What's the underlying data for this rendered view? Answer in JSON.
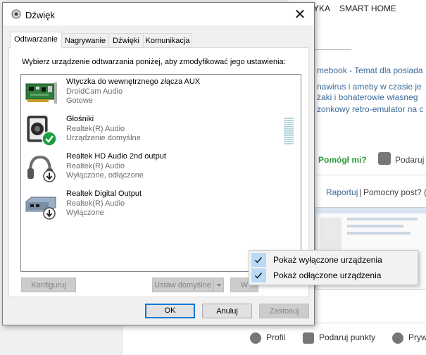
{
  "background_page": {
    "nav": [
      "YKA",
      "SMART HOME"
    ],
    "snippets": [
      "mebook - Temat dla posiada",
      "nawirus i ameby w czasie je",
      "żaki i bohaterowie własneg",
      "zonkowy retro-emulator na c"
    ],
    "help_label": "Pomógł mi?",
    "gift_label": "Podaruj",
    "report_label": "Raportuj",
    "separator": "|",
    "helpful_label": "Pomocny post? (",
    "footer": [
      "Profil",
      "Podaruj punkty",
      "Prywa"
    ]
  },
  "dialog": {
    "title": "Dźwięk",
    "close_glyph": "✕",
    "tabs": [
      "Odtwarzanie",
      "Nagrywanie",
      "Dźwięki",
      "Komunikacja"
    ],
    "instruction": "Wybierz urządzenie odtwarzania poniżej, aby zmodyfikować jego ustawienia:",
    "devices": [
      {
        "name": "Wtyczka do wewnętrznego złącza AUX",
        "driver": "DroidCam Audio",
        "status": "Gotowe",
        "icon": "sound-card-icon"
      },
      {
        "name": "Głośniki",
        "driver": "Realtek(R) Audio",
        "status": "Urządzenie domyślne",
        "icon": "speaker-icon",
        "badge": "default-check-icon"
      },
      {
        "name": "Realtek HD Audio 2nd output",
        "driver": "Realtek(R) Audio",
        "status": "Wyłączone, odłączone",
        "icon": "headphones-icon",
        "badge": "disabled-arrow-icon"
      },
      {
        "name": "Realtek Digital Output",
        "driver": "Realtek(R) Audio",
        "status": "Wyłączone",
        "icon": "digital-output-icon",
        "badge": "disabled-arrow-icon"
      }
    ],
    "buttons": {
      "configure": "Konfiguruj",
      "set_default": "Ustaw domyślne",
      "properties_partial": "W",
      "ok": "OK",
      "cancel": "Anuluj",
      "apply": "Zastosuj"
    }
  },
  "context_menu": {
    "items": [
      {
        "label": "Pokaż wyłączone urządzenia",
        "checked": true
      },
      {
        "label": "Pokaż odłączone urządzenia",
        "checked": true
      }
    ]
  },
  "colors": {
    "accent": "#0078d7",
    "check_badge": "#1a9e3f",
    "link": "#3a6a9a",
    "help_green": "#2e9c3a"
  }
}
